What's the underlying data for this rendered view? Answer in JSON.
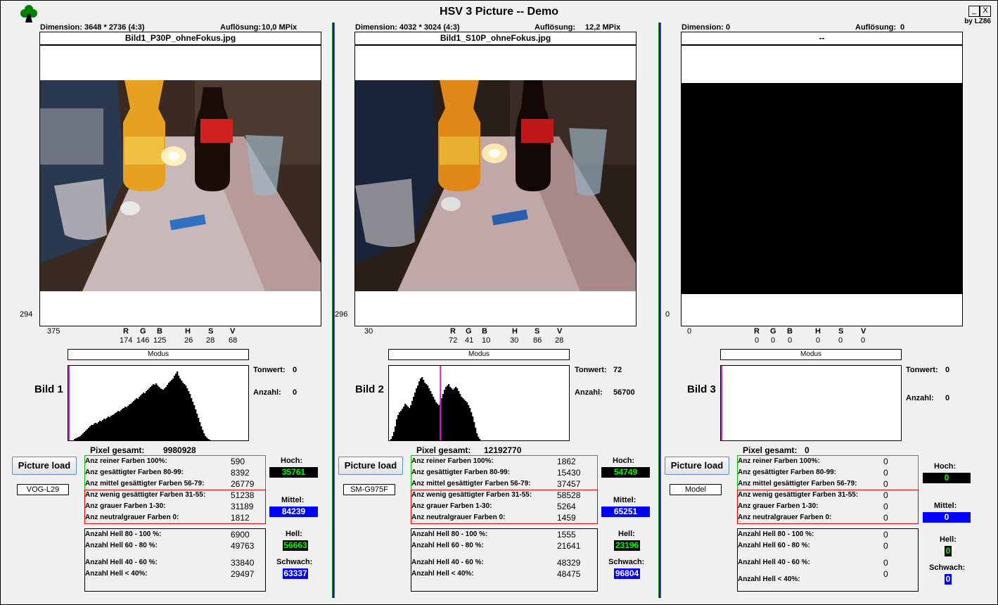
{
  "app": {
    "title": "HSV 3 Picture -- Demo",
    "by": "by LZ86",
    "min_label": "_",
    "close_label": "X"
  },
  "colors": {
    "green": "#00ff00",
    "blue": "#0000ff",
    "red": "#ff0000",
    "separator": "#0000c8",
    "marker": "#d020d0"
  },
  "panels": [
    {
      "dimension": "Dimension: 3648 * 2736 (4:3)",
      "aufloesung_label": "Auflösung:",
      "aufloesung": "10,0 MPix",
      "filename": "Bild1_P30P_ohneFokus.jpg",
      "y_coord": "294",
      "x_coord": "375",
      "rgb_labels": [
        "R",
        "G",
        "B"
      ],
      "rgb": [
        "174",
        "146",
        "125"
      ],
      "hsv_labels": [
        "H",
        "S",
        "V"
      ],
      "hsv": [
        "26",
        "28",
        "68"
      ],
      "modus": "Modus",
      "bild": "Bild 1",
      "tonwert_label": "Tonwert:",
      "tonwert": "0",
      "anzahl_label": "Anzahl:",
      "anzahl": "0",
      "pixel_label": "Pixel gesamt:",
      "pixel": "9980928",
      "load": "Picture load",
      "model": "VOG-L29",
      "green": [
        {
          "l": "Anz reiner Farben 100%:",
          "v": "590"
        },
        {
          "l": "Anz gesättigter Farben 80-99:",
          "v": "8392"
        },
        {
          "l": "Anz mittel gesättigter Farben 56-79:",
          "v": "26779"
        }
      ],
      "red": [
        {
          "l": "Anz wenig gesättigter Farben 31-55:",
          "v": "51238"
        },
        {
          "l": "Anz grauer Farben 1-30:",
          "v": "31189"
        },
        {
          "l": "Anz neutralgrauer Farben 0:",
          "v": "1812"
        }
      ],
      "hell": [
        {
          "l": "Anzahl Hell 80 - 100 %:",
          "v": "6900"
        },
        {
          "l": "Anzahl Hell 60 - 80 %:",
          "v": "49763"
        },
        {
          "l": "Anzahl Hell 40 - 60 %:",
          "v": "33840"
        },
        {
          "l": "Anzahl Hell < 40%:",
          "v": "29497"
        }
      ],
      "hoch_label": "Hoch:",
      "hoch": "35761",
      "mittel_label": "Mittel:",
      "mittel": "84239",
      "hell_label": "Hell:",
      "hell_v": "56663",
      "schwach_label": "Schwach:",
      "schwach": "63337",
      "hist_marker": 0,
      "histogram": [
        0,
        0,
        0,
        0,
        2,
        3,
        4,
        5,
        6,
        8,
        10,
        12,
        14,
        16,
        18,
        20,
        22,
        22,
        24,
        25,
        24,
        26,
        28,
        27,
        29,
        31,
        30,
        32,
        34,
        33,
        35,
        36,
        37,
        39,
        40,
        42,
        41,
        43,
        45,
        46,
        48,
        47,
        49,
        51,
        52,
        54,
        56,
        58,
        60,
        59,
        62,
        64,
        66,
        68,
        67,
        70,
        72,
        74,
        76,
        78,
        80,
        79,
        81,
        78,
        76,
        74,
        73,
        72,
        74,
        76,
        79,
        82,
        84,
        86,
        88,
        92,
        95,
        98,
        92,
        88,
        85,
        82,
        80,
        78,
        74,
        70,
        66,
        60,
        55,
        50,
        44,
        38,
        32,
        26,
        20,
        15,
        10,
        6,
        4,
        2,
        1,
        0,
        0,
        0,
        0,
        0,
        0,
        0,
        0,
        0,
        0,
        0,
        0,
        0,
        0,
        0,
        0,
        0,
        0,
        0,
        0,
        0,
        0,
        0,
        0,
        0,
        0,
        0
      ]
    },
    {
      "dimension": "Dimension: 4032 * 3024 (4:3)",
      "aufloesung_label": "Auflösung:",
      "aufloesung": "12,2 MPix",
      "filename": "Bild1_S10P_ohneFokus.jpg",
      "y_coord": "296",
      "x_coord": "30",
      "rgb_labels": [
        "R",
        "G",
        "B"
      ],
      "rgb": [
        "72",
        "41",
        "10"
      ],
      "hsv_labels": [
        "H",
        "S",
        "V"
      ],
      "hsv": [
        "30",
        "86",
        "28"
      ],
      "modus": "Modus",
      "bild": "Bild 2",
      "tonwert_label": "Tonwert:",
      "tonwert": "72",
      "anzahl_label": "Anzahl:",
      "anzahl": "56700",
      "pixel_label": "Pixel gesamt:",
      "pixel": "12192770",
      "load": "Picture load",
      "model": "SM-G975F",
      "green": [
        {
          "l": "Anz reiner Farben 100%:",
          "v": "1862"
        },
        {
          "l": "Anz gesättigter Farben 80-99:",
          "v": "15430"
        },
        {
          "l": "Anz mittel gesättigter Farben 56-79:",
          "v": "37457"
        }
      ],
      "red": [
        {
          "l": "Anz wenig gesättigter Farben 31-55:",
          "v": "58528"
        },
        {
          "l": "Anz grauer Farben 1-30:",
          "v": "5264"
        },
        {
          "l": "Anz neutralgrauer Farben 0:",
          "v": "1459"
        }
      ],
      "hell": [
        {
          "l": "Anzahl Hell 80 - 100 %:",
          "v": "1555"
        },
        {
          "l": "Anzahl Hell 60 - 80 %:",
          "v": "21641"
        },
        {
          "l": "Anzahl Hell 40 - 60 %:",
          "v": "48329"
        },
        {
          "l": "Anzahl Hell < 40%:",
          "v": "48475"
        }
      ],
      "hoch_label": "Hoch:",
      "hoch": "54749",
      "mittel_label": "Mittel:",
      "mittel": "65251",
      "hell_label": "Hell:",
      "hell_v": "23196",
      "schwach_label": "Schwach:",
      "schwach": "96804",
      "hist_marker": 72,
      "histogram": [
        0,
        2,
        6,
        12,
        20,
        30,
        36,
        40,
        42,
        45,
        48,
        52,
        50,
        48,
        46,
        50,
        56,
        62,
        68,
        74,
        78,
        84,
        88,
        90,
        86,
        82,
        80,
        78,
        74,
        70,
        66,
        62,
        58,
        54,
        52,
        50,
        54,
        60,
        66,
        72,
        76,
        78,
        80,
        76,
        74,
        72,
        74,
        76,
        74,
        70,
        66,
        62,
        60,
        58,
        56,
        54,
        50,
        46,
        40,
        34,
        26,
        18,
        10,
        5,
        2,
        0,
        0,
        0,
        0,
        0,
        0,
        0,
        0,
        0,
        0,
        0,
        0,
        0,
        0,
        0,
        0,
        0,
        0,
        0,
        0,
        0,
        0,
        0,
        0,
        0,
        0,
        0,
        0,
        0,
        0,
        0,
        0,
        0,
        0,
        0,
        0,
        0,
        0,
        0,
        0,
        0,
        0,
        0,
        0,
        0,
        0,
        0,
        0,
        0,
        0,
        0,
        0,
        0,
        0,
        0,
        0,
        0,
        0,
        0,
        0,
        0,
        0,
        0
      ]
    },
    {
      "dimension": "Dimension: 0",
      "aufloesung_label": "Auflösung:",
      "aufloesung": "0",
      "filename": "--",
      "y_coord": "0",
      "x_coord": "0",
      "rgb_labels": [
        "R",
        "G",
        "B"
      ],
      "rgb": [
        "0",
        "0",
        "0"
      ],
      "hsv_labels": [
        "H",
        "S",
        "V"
      ],
      "hsv": [
        "0",
        "0",
        "0"
      ],
      "modus": "Modus",
      "bild": "Bild 3",
      "tonwert_label": "Tonwert:",
      "tonwert": "0",
      "anzahl_label": "Anzahl:",
      "anzahl": "0",
      "pixel_label": "Pixel gesamt:",
      "pixel": "0",
      "load": "Picture load",
      "model": "Model",
      "green": [
        {
          "l": "Anz reiner Farben 100%:",
          "v": "0"
        },
        {
          "l": "Anz gesättigter Farben 80-99:",
          "v": "0"
        },
        {
          "l": "Anz mittel gesättigter Farben 56-79:",
          "v": "0"
        }
      ],
      "red": [
        {
          "l": "Anz wenig gesättigter Farben 31-55:",
          "v": "0"
        },
        {
          "l": "Anz grauer Farben 1-30:",
          "v": "0"
        },
        {
          "l": "Anz neutralgrauer Farben 0:",
          "v": "0"
        }
      ],
      "hell": [
        {
          "l": "Anzahl Hell 80 - 100 %:",
          "v": "0"
        },
        {
          "l": "Anzahl Hell 60 - 80 %:",
          "v": "0"
        },
        {
          "l": "Anzahl Hell 40 - 60 %:",
          "v": "0"
        },
        {
          "l": "Anzahl Hell < 40%:",
          "v": "0"
        }
      ],
      "hoch_label": "Hoch:",
      "hoch": "0",
      "mittel_label": "Mittel:",
      "mittel": "0",
      "hell_label": "Hell:",
      "hell_v": "0",
      "schwach_label": "Schwach:",
      "schwach": "0",
      "hist_marker": 0,
      "histogram": []
    }
  ]
}
